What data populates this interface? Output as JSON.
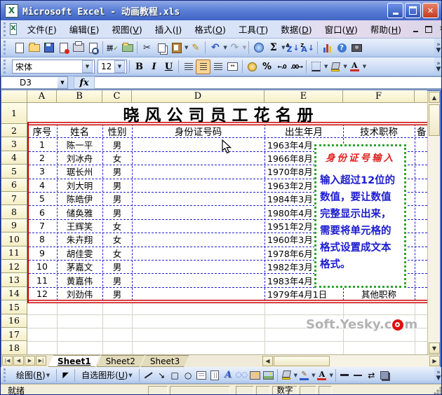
{
  "window": {
    "title": "Microsoft Excel - 动画教程.xls",
    "controls": [
      "minimize",
      "maximize",
      "close"
    ]
  },
  "menu_bar": {
    "items": [
      "文件(F)",
      "编辑(E)",
      "视图(V)",
      "插入(I)",
      "格式(O)",
      "工具(T)",
      "数据(D)",
      "窗口(W)",
      "帮助(H)"
    ],
    "doc_controls": [
      "minimize",
      "restore",
      "close"
    ]
  },
  "toolbars": {
    "standard_icons": [
      "new-document",
      "open-folder",
      "save",
      "permission",
      "print",
      "print-preview",
      "sep",
      "spelling",
      "research",
      "sep",
      "cut",
      "copy",
      "paste",
      "format-painter",
      "sep",
      "undo",
      "redo",
      "sep",
      "insert-hyperlink",
      "autosum",
      "sort-ascending",
      "sort-descending",
      "sep",
      "chart-wizard",
      "help",
      "camera"
    ],
    "formatting": {
      "font_name": "宋体",
      "font_size": "12",
      "icons": [
        "bold",
        "italic",
        "underline",
        "sep",
        "align-left",
        "align-center",
        "align-right",
        "merge-center",
        "sep",
        "currency",
        "percent",
        "increase-decimal",
        "decrease-decimal",
        "sep",
        "borders",
        "fill-color",
        "font-color"
      ]
    }
  },
  "formula_bar": {
    "name_box": "D3",
    "fx_label": "fx"
  },
  "sheet": {
    "col_headers": [
      "A",
      "B",
      "C",
      "D",
      "E",
      "F"
    ],
    "row_headers": [
      "1",
      "2",
      "3",
      "4",
      "5",
      "6",
      "7",
      "8",
      "9",
      "10",
      "11",
      "12",
      "13",
      "14",
      "15",
      "16",
      "17",
      "18"
    ],
    "title_row": "晓风公司员工花名册",
    "header_row": [
      "序号",
      "姓名",
      "性别",
      "身份证号码",
      "出生年月",
      "技术职称",
      "备"
    ],
    "rows": [
      [
        "1",
        "陈一平",
        "男",
        "",
        "1963年4月",
        ""
      ],
      [
        "2",
        "刘冰舟",
        "女",
        "",
        "1966年8月",
        ""
      ],
      [
        "3",
        "琚长州",
        "男",
        "",
        "1970年8月",
        ""
      ],
      [
        "4",
        "刘大明",
        "男",
        "",
        "1963年2月",
        ""
      ],
      [
        "5",
        "陈皓伊",
        "男",
        "",
        "1984年3月",
        ""
      ],
      [
        "6",
        "储奂雅",
        "男",
        "",
        "1980年4月",
        ""
      ],
      [
        "7",
        "王辉笑",
        "女",
        "",
        "1951年2月",
        ""
      ],
      [
        "8",
        "朱卉翔",
        "女",
        "",
        "1960年3月",
        ""
      ],
      [
        "9",
        "胡佳雯",
        "女",
        "",
        "1978年6月",
        ""
      ],
      [
        "10",
        "茅嘉文",
        "男",
        "",
        "1982年3月",
        ""
      ],
      [
        "11",
        "黄嘉伟",
        "男",
        "",
        "1983年4月",
        ""
      ],
      [
        "12",
        "刘劲伟",
        "男",
        "",
        "1979年4月1日",
        "其他职称"
      ]
    ]
  },
  "comment_box": {
    "title": "身份证号输入",
    "lines": [
      "输入超过12位的",
      "数值，要让数值",
      "完整显示出来，",
      "需要将单元格的",
      "格式设置成文本",
      "格式。"
    ]
  },
  "watermark": {
    "prefix": "Soft.Yesky.c",
    "suffix": "m"
  },
  "tab_bar": {
    "tabs": [
      "Sheet1",
      "Sheet2",
      "Sheet3"
    ],
    "active": "Sheet1"
  },
  "drawing_bar": {
    "draw_label": "绘图(R)",
    "autoshapes_label": "自选图形(U)",
    "icons": [
      "select-arrow",
      "sep-label",
      "line",
      "arrow",
      "rectangle",
      "oval",
      "text-box",
      "vertical-text-box",
      "wordart",
      "diagram",
      "clip-art",
      "picture",
      "sep",
      "shape-fill-color",
      "shape-line-color",
      "shape-font-color",
      "sep",
      "line-style",
      "dash-style",
      "arrow-style",
      "shadow-style"
    ]
  },
  "status_bar": {
    "left": "就绪",
    "num_indicator": "数字"
  },
  "colors": {
    "table_border_red": "#CC0000",
    "table_grid_blue": "#2222CC",
    "comment_border_green": "#2FA32F",
    "comment_title_red": "#E02020",
    "comment_text_blue": "#1C1CCF",
    "header_fill_yellow": "#F5EEC6"
  }
}
